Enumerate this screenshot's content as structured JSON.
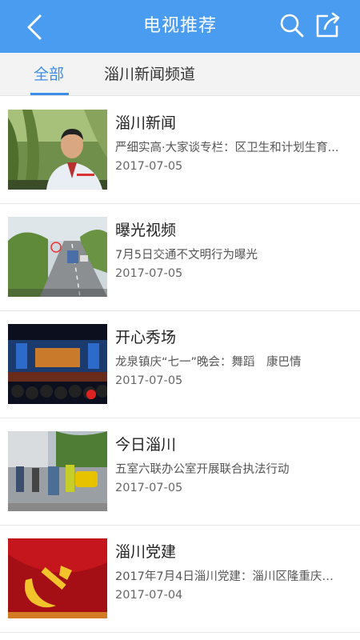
{
  "header": {
    "title": "电视推荐",
    "back_icon": "chevron-left-icon",
    "search_icon": "search-icon",
    "share_icon": "share-icon",
    "background": "#4a9cf0"
  },
  "tabs": [
    {
      "label": "全部",
      "active": true
    },
    {
      "label": "淄川新闻频道",
      "active": false
    }
  ],
  "accent": "#3d8ee8",
  "items": [
    {
      "title": "淄川新闻",
      "desc": "严细实高·大家谈专栏：区卫生和计划生育...",
      "date": "2017-07-05",
      "thumb": "news-anchor-thumbnail"
    },
    {
      "title": "曝光视频",
      "desc": "7月5日交通不文明行为曝光",
      "date": "2017-07-05",
      "thumb": "traffic-camera-thumbnail"
    },
    {
      "title": "开心秀场",
      "desc": "龙泉镇庆“七一”晚会：舞蹈　康巴情",
      "date": "2017-07-05",
      "thumb": "stage-performance-thumbnail"
    },
    {
      "title": "今日淄川",
      "desc": "五室六联办公室开展联合执法行动",
      "date": "2017-07-05",
      "thumb": "street-enforcement-thumbnail"
    },
    {
      "title": "淄川党建",
      "desc": "2017年7月4日淄川党建：淄川区隆重庆祝...",
      "date": "2017-07-04",
      "thumb": "party-emblem-thumbnail"
    }
  ]
}
